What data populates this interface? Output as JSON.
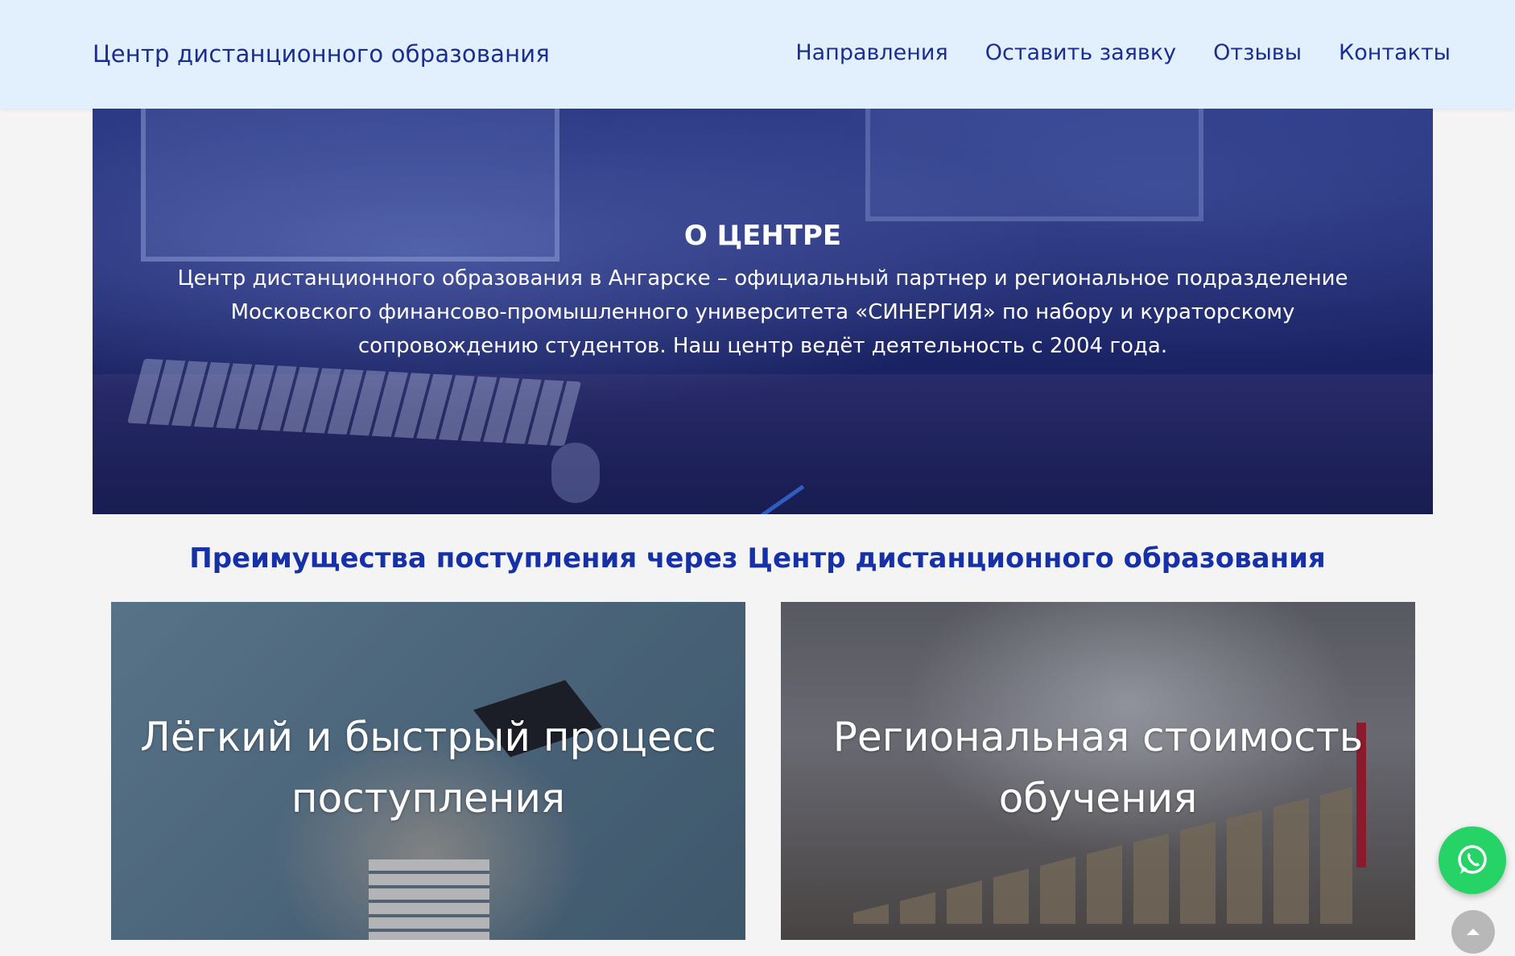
{
  "header": {
    "brand": "Центр дистанционного образования",
    "nav": [
      "Направления",
      "Оставить заявку",
      "Отзывы",
      "Контакты"
    ]
  },
  "hero": {
    "title": "О ЦЕНТРЕ",
    "text": "Центр дистанционного образования в Ангарске – официальный партнер и региональное подразделение Московского финансово-промышленного университета «СИНЕРГИЯ» по набору и кураторскому сопровождению студентов. Наш центр ведёт деятельность с 2004 года."
  },
  "advantages": {
    "title": "Преимущества поступления через Центр дистанционного образования",
    "cards": [
      {
        "title": "Лёгкий и быстрый процесс поступления"
      },
      {
        "title": "Региональная стоимость обучения"
      }
    ]
  },
  "floating": {
    "whatsapp_icon": "whatsapp-icon",
    "scroll_top_icon": "chevron-up-icon",
    "whatsapp_color": "#25d366"
  }
}
